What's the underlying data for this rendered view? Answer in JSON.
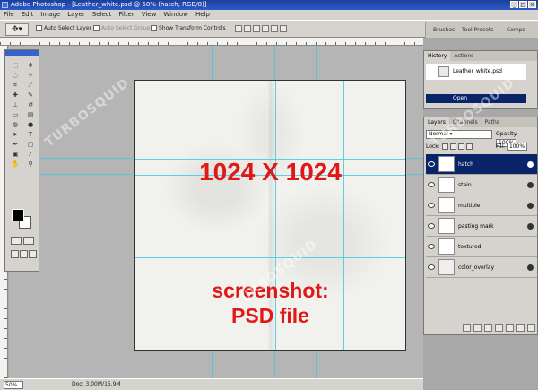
{
  "titlebar": {
    "title": "Adobe Photoshop - [Leather_white.psd @ 50% (hatch, RGB/8)]"
  },
  "menu": [
    "File",
    "Edit",
    "Image",
    "Layer",
    "Select",
    "Filter",
    "View",
    "Window",
    "Help"
  ],
  "options": {
    "auto_select_layer": "Auto Select Layer",
    "auto_select_groups": "Auto Select Groups",
    "show_transform": "Show Transform Controls",
    "palette_tabs": [
      "Brushes",
      "Tool Presets",
      "Comps"
    ]
  },
  "canvas": {
    "size_label": "1024 X 1024",
    "shot_line1": "screenshot:",
    "shot_line2": "PSD file"
  },
  "status": {
    "zoom": "50%",
    "doc": "Doc: 3.00M/15.9M"
  },
  "history": {
    "tabs": [
      "History",
      "Actions"
    ],
    "snapshot": "Leather_white.psd",
    "step": "Open"
  },
  "layers_panel": {
    "tabs": [
      "Layers",
      "Channels",
      "Paths"
    ],
    "blend_mode": "Normal",
    "opacity_label": "Opacity:",
    "opacity_value": "100%",
    "lock_label": "Lock:",
    "fill_label": "Fill:",
    "fill_value": "100%",
    "layers": [
      "hatch",
      "stain",
      "multiple",
      "pasting mark",
      "textured",
      "color_overlay"
    ]
  },
  "watermark": {
    "text": "TURBOSQUID"
  }
}
